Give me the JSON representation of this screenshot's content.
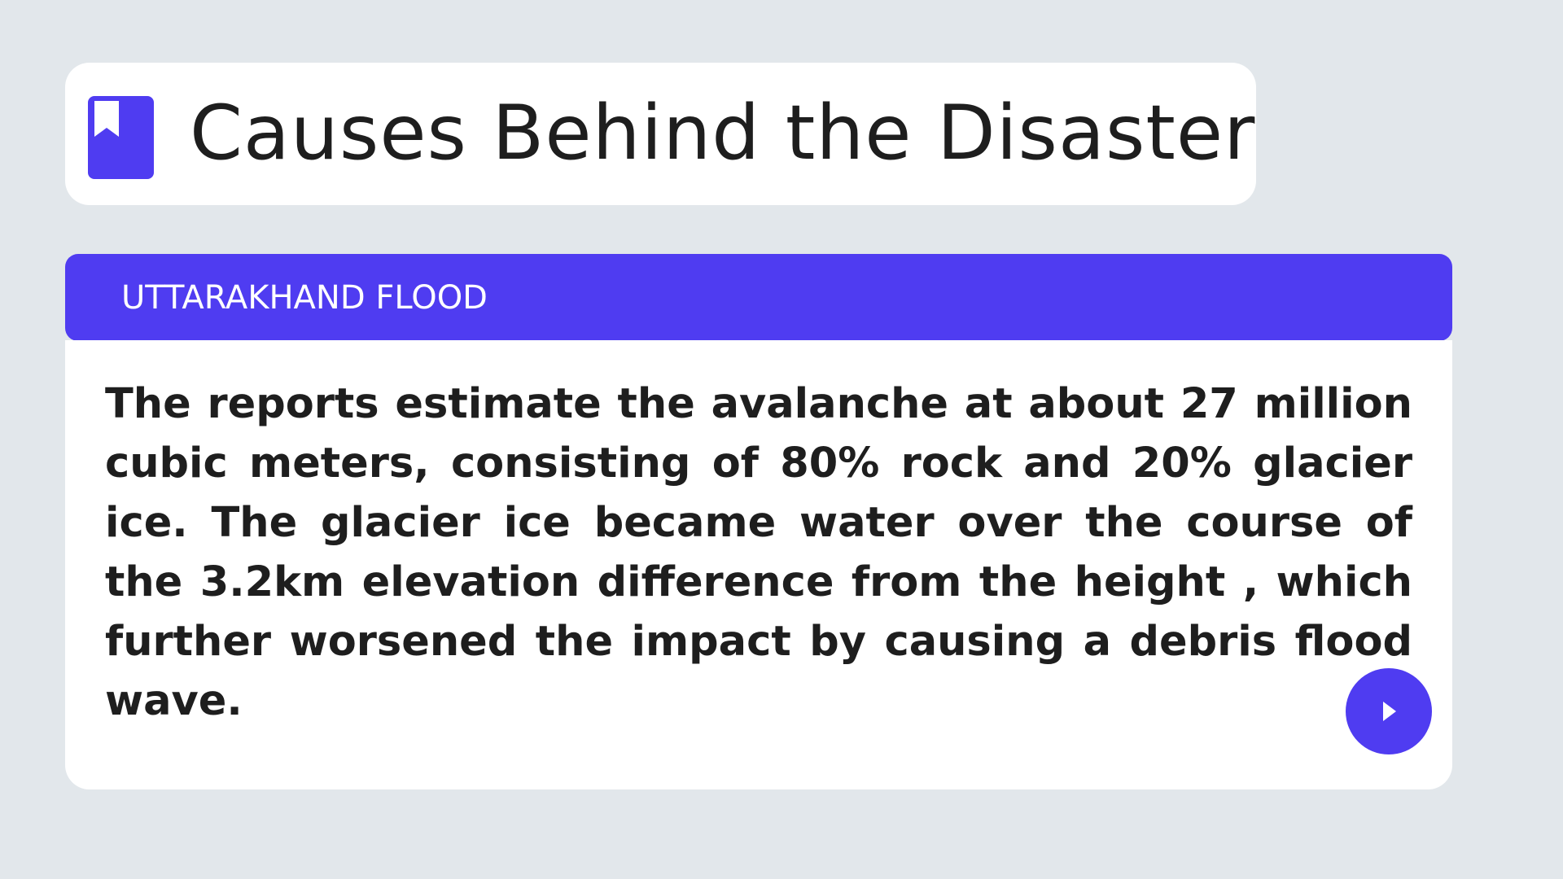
{
  "title_card": {
    "icon": "bookmark-icon",
    "title": "Causes Behind the Disaster"
  },
  "section": {
    "label": "UTTARAKHAND FLOOD",
    "body": "The reports estimate the avalanche at about 27 million cubic meters, consisting of 80% rock and 20% glacier ice. The glacier ice became water over the course of the 3.2km elevation difference from the height , which further worsened the impact by causing a debris flood wave."
  },
  "controls": {
    "play_icon": "play-icon"
  },
  "colors": {
    "background": "#e2e7eb",
    "accent": "#4f3cf1",
    "card": "#ffffff",
    "text": "#1e1e1e"
  }
}
